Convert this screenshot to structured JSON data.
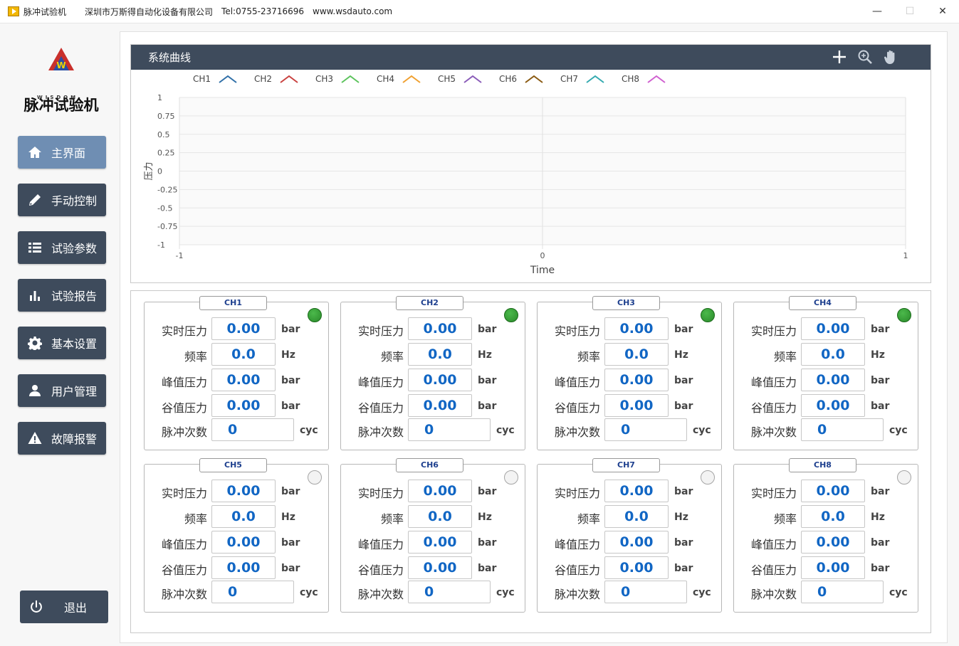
{
  "window": {
    "title": "脉冲试验机",
    "company": "深圳市万斯得自动化设备有限公司",
    "tel": "Tel:0755-23716696",
    "web": "www.wsdauto.com",
    "minimize": "—",
    "maximize": "☐",
    "close": "✕"
  },
  "sidebar": {
    "logo_text": "WISDOM",
    "app_name": "脉冲试验机",
    "items": [
      {
        "label": "主界面",
        "icon": "home-icon",
        "active": true
      },
      {
        "label": "手动控制",
        "icon": "pencil-icon",
        "active": false
      },
      {
        "label": "试验参数",
        "icon": "list-icon",
        "active": false
      },
      {
        "label": "试验报告",
        "icon": "bar-chart-icon",
        "active": false
      },
      {
        "label": "基本设置",
        "icon": "gear-icon",
        "active": false
      },
      {
        "label": "用户管理",
        "icon": "user-icon",
        "active": false
      },
      {
        "label": "故障报警",
        "icon": "warning-icon",
        "active": false
      }
    ],
    "exit_label": "退出"
  },
  "chart": {
    "title": "系统曲线",
    "tools": [
      "crosshair-icon",
      "zoom-icon",
      "pan-hand-icon"
    ]
  },
  "chart_data": {
    "type": "line",
    "title": "",
    "xlabel": "Time",
    "ylabel": "压力",
    "xlim": [
      -1,
      1
    ],
    "ylim": [
      -1,
      1
    ],
    "x_ticks": [
      "-1",
      "0",
      "1"
    ],
    "y_ticks": [
      "1",
      "0.75",
      "0.5",
      "0.25",
      "0",
      "-0.25",
      "-0.5",
      "-0.75",
      "-1"
    ],
    "grid": true,
    "legend_position": "top",
    "series": [
      {
        "name": "CH1",
        "color": "#2f6fa8",
        "values": []
      },
      {
        "name": "CH2",
        "color": "#c9413f",
        "values": []
      },
      {
        "name": "CH3",
        "color": "#5cc35c",
        "values": []
      },
      {
        "name": "CH4",
        "color": "#f0a030",
        "values": []
      },
      {
        "name": "CH5",
        "color": "#8a5cb8",
        "values": []
      },
      {
        "name": "CH6",
        "color": "#8a5a12",
        "values": []
      },
      {
        "name": "CH7",
        "color": "#35aab0",
        "values": []
      },
      {
        "name": "CH8",
        "color": "#d060d0",
        "values": []
      }
    ]
  },
  "labels": {
    "realtime": "实时压力",
    "freq": "频率",
    "peak": "峰值压力",
    "valley": "谷值压力",
    "count": "脉冲次数",
    "unit_bar": "bar",
    "unit_hz": "Hz",
    "unit_cyc": "cyc"
  },
  "channels": [
    {
      "name": "CH1",
      "status": "on",
      "realtime": "0.00",
      "freq": "0.0",
      "peak": "0.00",
      "valley": "0.00",
      "count": "0"
    },
    {
      "name": "CH2",
      "status": "on",
      "realtime": "0.00",
      "freq": "0.0",
      "peak": "0.00",
      "valley": "0.00",
      "count": "0"
    },
    {
      "name": "CH3",
      "status": "on",
      "realtime": "0.00",
      "freq": "0.0",
      "peak": "0.00",
      "valley": "0.00",
      "count": "0"
    },
    {
      "name": "CH4",
      "status": "on",
      "realtime": "0.00",
      "freq": "0.0",
      "peak": "0.00",
      "valley": "0.00",
      "count": "0"
    },
    {
      "name": "CH5",
      "status": "off",
      "realtime": "0.00",
      "freq": "0.0",
      "peak": "0.00",
      "valley": "0.00",
      "count": "0"
    },
    {
      "name": "CH6",
      "status": "off",
      "realtime": "0.00",
      "freq": "0.0",
      "peak": "0.00",
      "valley": "0.00",
      "count": "0"
    },
    {
      "name": "CH7",
      "status": "off",
      "realtime": "0.00",
      "freq": "0.0",
      "peak": "0.00",
      "valley": "0.00",
      "count": "0"
    },
    {
      "name": "CH8",
      "status": "off",
      "realtime": "0.00",
      "freq": "0.0",
      "peak": "0.00",
      "valley": "0.00",
      "count": "0"
    }
  ],
  "colors": {
    "nav_bg": "#3e4b5c",
    "nav_active": "#6f8eb3",
    "value_text": "#1166c4",
    "led_on": "#2e9a2e"
  }
}
